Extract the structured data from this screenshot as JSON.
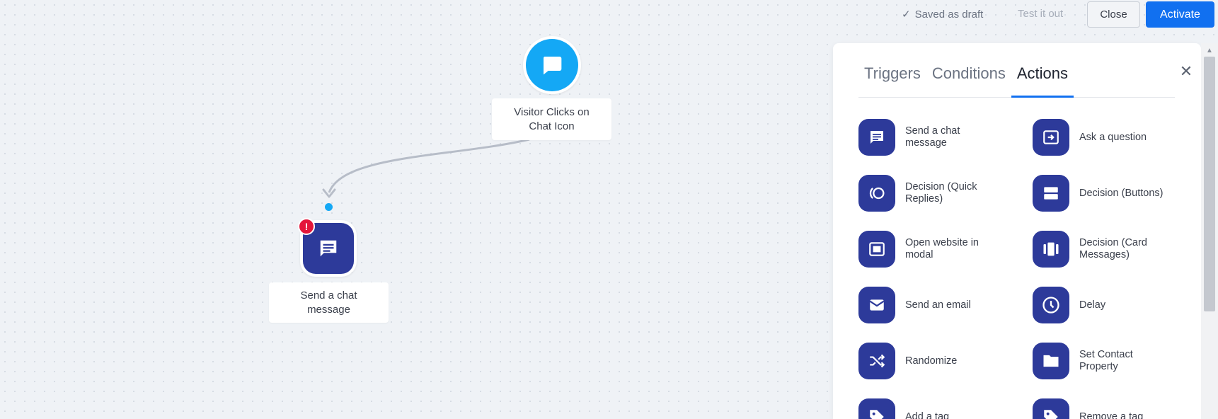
{
  "topbar": {
    "saved_label": "Saved as draft",
    "test_label": "Test it out",
    "close_label": "Close",
    "activate_label": "Activate"
  },
  "canvas": {
    "trigger_node": {
      "label": "Visitor Clicks on Chat Icon",
      "icon": "chat-bubble-icon"
    },
    "action_node": {
      "label": "Send a chat message",
      "icon": "message-icon",
      "error_badge": "!"
    }
  },
  "panel": {
    "tabs": [
      {
        "label": "Triggers",
        "active": false
      },
      {
        "label": "Conditions",
        "active": false
      },
      {
        "label": "Actions",
        "active": true
      }
    ],
    "items": [
      {
        "label": "Send a chat message",
        "icon": "message-icon"
      },
      {
        "label": "Ask a question",
        "icon": "input-icon"
      },
      {
        "label": "Decision (Quick Replies)",
        "icon": "quick-replies-icon"
      },
      {
        "label": "Decision (Buttons)",
        "icon": "buttons-icon"
      },
      {
        "label": "Open website in modal",
        "icon": "modal-icon"
      },
      {
        "label": "Decision (Card Messages)",
        "icon": "cards-icon"
      },
      {
        "label": "Send an email",
        "icon": "email-icon"
      },
      {
        "label": "Delay",
        "icon": "clock-icon"
      },
      {
        "label": "Randomize",
        "icon": "shuffle-icon"
      },
      {
        "label": "Set Contact Property",
        "icon": "folder-icon"
      },
      {
        "label": "Add a tag",
        "icon": "tag-icon"
      },
      {
        "label": "Remove a tag",
        "icon": "tag-icon"
      }
    ]
  },
  "colors": {
    "accent": "#1170f0",
    "trigger": "#14a8f5",
    "action": "#2d3a9a",
    "error": "#e4163a"
  }
}
